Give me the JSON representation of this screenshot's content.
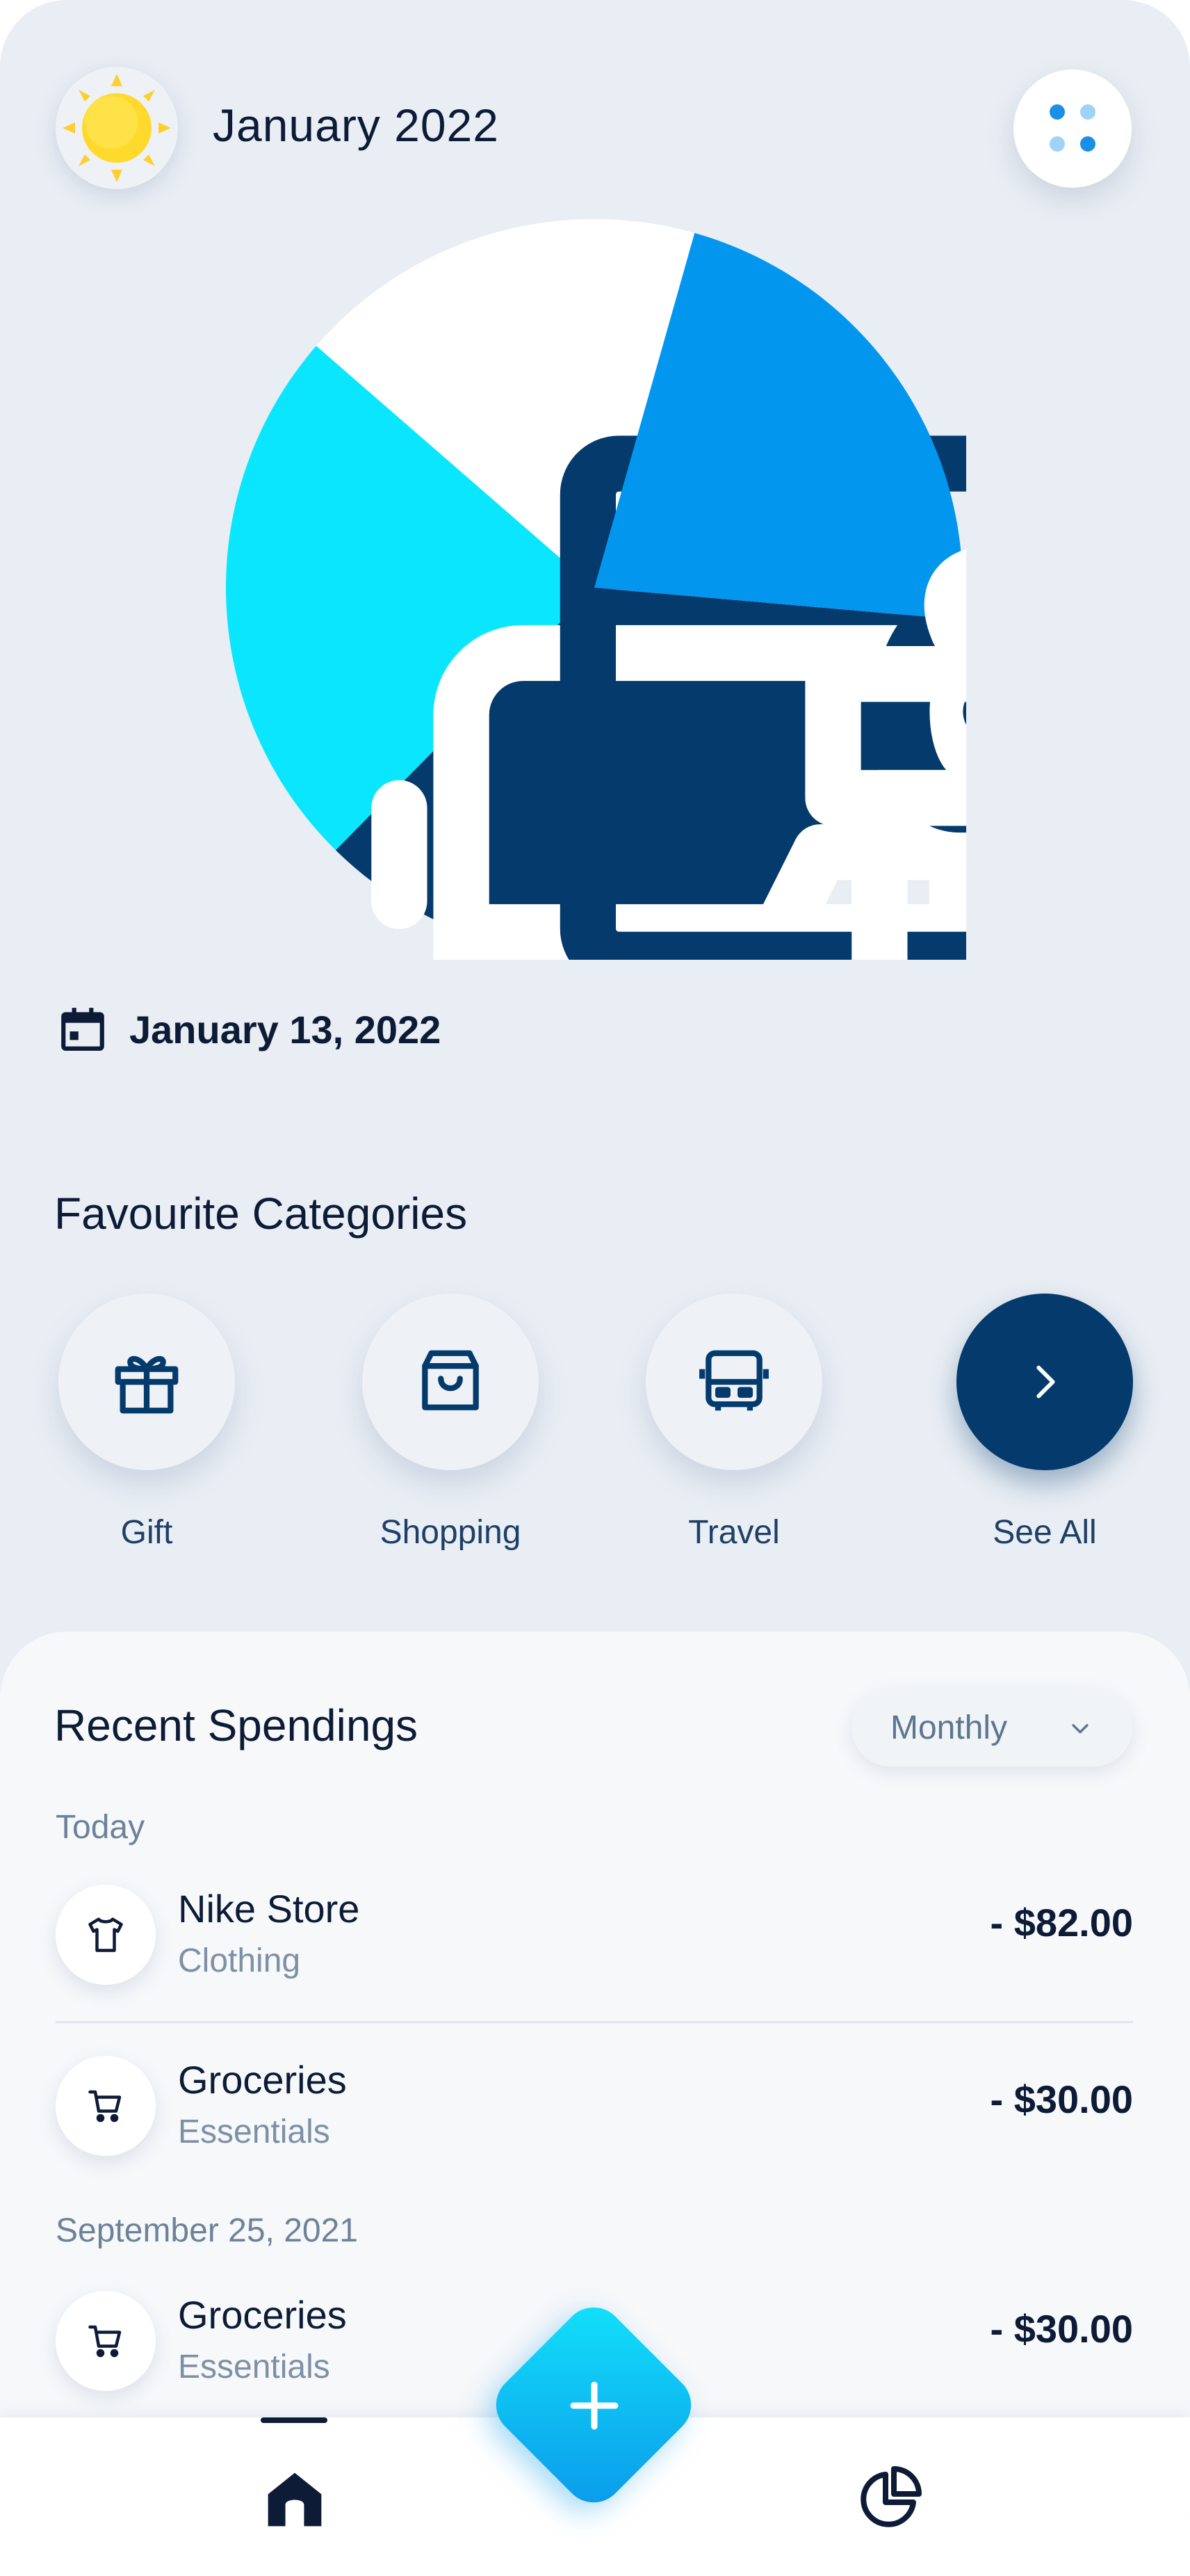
{
  "header": {
    "title": "January 2022",
    "avatar_icon": "sun-icon",
    "menu_icon": "dots-grid-icon"
  },
  "chart_data": {
    "type": "pie",
    "slices": [
      {
        "category": "Shopping",
        "icon": "shopping-bag-icon",
        "color": "#043a6c",
        "value": 36
      },
      {
        "category": "Travel",
        "icon": "bus-icon",
        "color": "#0ae6fd",
        "value": 24
      },
      {
        "category": "Wallet",
        "icon": "wallet-icon",
        "color": "#ffffff",
        "value": 18
      },
      {
        "category": "Gift",
        "icon": "gift-icon",
        "color": "#0396ef",
        "value": 22
      }
    ]
  },
  "date": {
    "label": "January 13, 2022",
    "icon": "calendar-icon"
  },
  "favourites": {
    "title": "Favourite Categories",
    "items": [
      {
        "label": "Gift",
        "icon": "gift-icon"
      },
      {
        "label": "Shopping",
        "icon": "shopping-bag-icon"
      },
      {
        "label": "Travel",
        "icon": "bus-icon"
      },
      {
        "label": "See All",
        "icon": "chevron-right-icon"
      }
    ]
  },
  "recent": {
    "title": "Recent Spendings",
    "filter": "Monthly",
    "groups": [
      {
        "label": "Today",
        "transactions": [
          {
            "name": "Nike Store",
            "category": "Clothing",
            "amount": "- $82.00",
            "icon": "tshirt-icon"
          },
          {
            "name": "Groceries",
            "category": "Essentials",
            "amount": "- $30.00",
            "icon": "cart-icon"
          }
        ]
      },
      {
        "label": "September 25, 2021",
        "transactions": [
          {
            "name": "Groceries",
            "category": "Essentials",
            "amount": "- $30.00",
            "icon": "cart-icon"
          }
        ]
      }
    ]
  },
  "nav": {
    "items": [
      {
        "name": "home",
        "icon": "home-icon",
        "active": true
      },
      {
        "name": "statistics",
        "icon": "pie-chart-icon",
        "active": false
      }
    ],
    "fab_icon": "plus-icon"
  },
  "colors": {
    "background": "#e9eef4",
    "primary_dark": "#043a6c",
    "accent_blue": "#0396ef",
    "accent_cyan": "#0ae6fd",
    "text": "#0d1b36"
  }
}
